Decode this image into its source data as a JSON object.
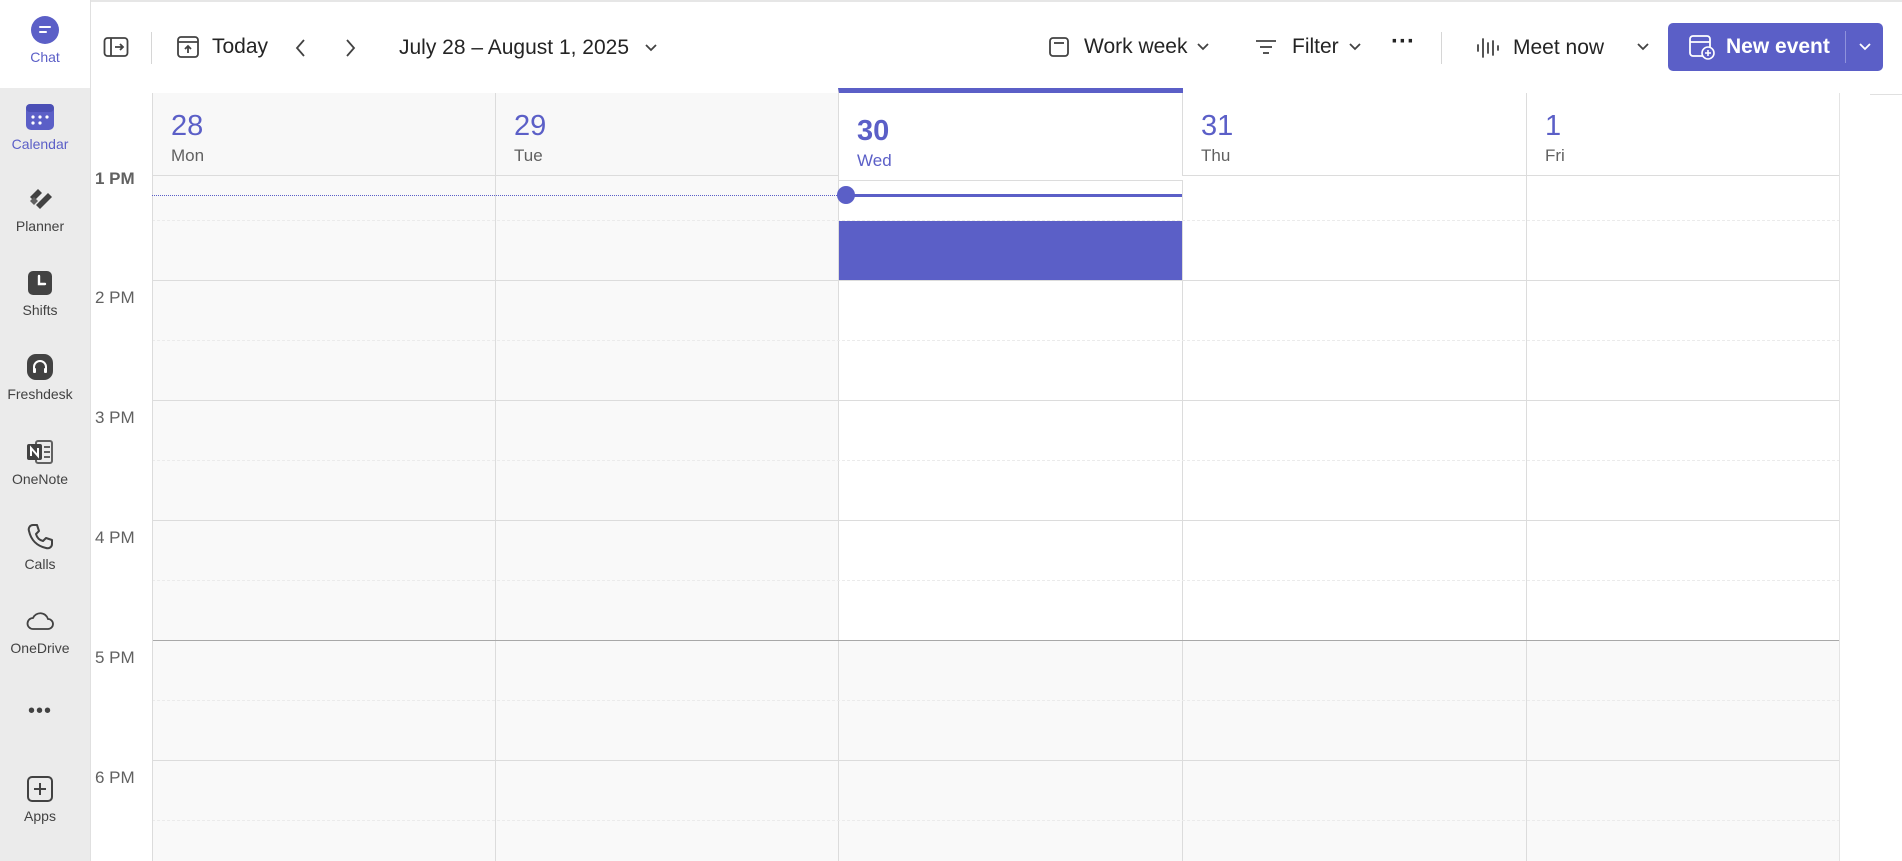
{
  "rail": {
    "items": [
      {
        "label": "Chat",
        "icon": "chat-icon",
        "active": false
      },
      {
        "label": "Calendar",
        "icon": "calendar-icon",
        "active": true
      },
      {
        "label": "Planner",
        "icon": "planner-icon"
      },
      {
        "label": "Shifts",
        "icon": "shifts-icon"
      },
      {
        "label": "Freshdesk",
        "icon": "freshdesk-icon"
      },
      {
        "label": "OneNote",
        "icon": "onenote-icon"
      },
      {
        "label": "Calls",
        "icon": "phone-icon"
      },
      {
        "label": "OneDrive",
        "icon": "cloud-icon"
      },
      {
        "label": "Apps",
        "icon": "add-app-icon"
      }
    ],
    "more_glyph": "•••"
  },
  "toolbar": {
    "today_label": "Today",
    "date_range": "July 28 – August 1, 2025",
    "view_label": "Work week",
    "filter_label": "Filter",
    "more_glyph": "···",
    "meet_now_label": "Meet now",
    "new_event_label": "New event"
  },
  "days": [
    {
      "num": "28",
      "name": "Mon"
    },
    {
      "num": "29",
      "name": "Tue"
    },
    {
      "num": "30",
      "name": "Wed",
      "today": true
    },
    {
      "num": "31",
      "name": "Thu"
    },
    {
      "num": "1",
      "name": "Fri"
    }
  ],
  "hours": [
    "1 PM",
    "2 PM",
    "3 PM",
    "4 PM",
    "5 PM",
    "6 PM"
  ],
  "colors": {
    "accent": "#5b5fc7",
    "rail_bg": "#ebebeb",
    "grid_line": "#dcdcdc",
    "off_hours_bg": "#f9f9f9"
  }
}
